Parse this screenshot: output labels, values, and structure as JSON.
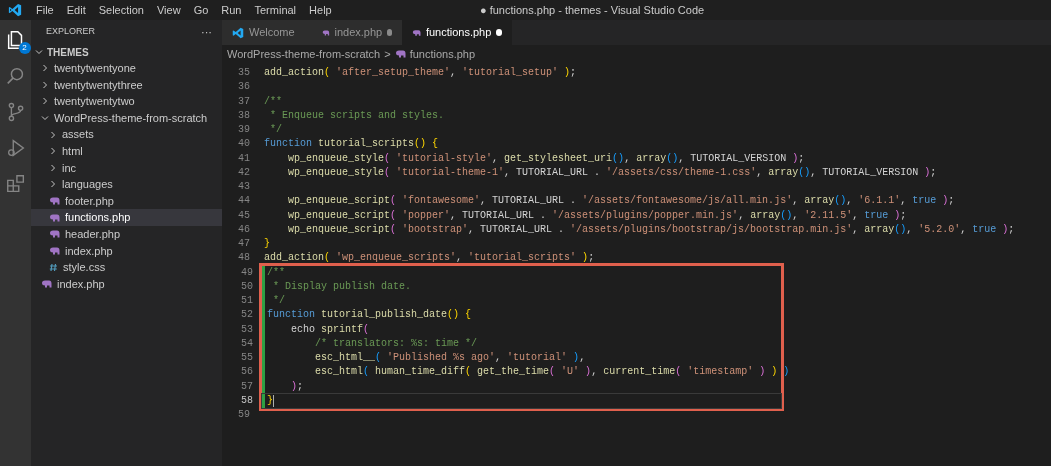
{
  "window": {
    "title": "● functions.php - themes - Visual Studio Code"
  },
  "menu": [
    "File",
    "Edit",
    "Selection",
    "View",
    "Go",
    "Run",
    "Terminal",
    "Help"
  ],
  "activity_bar": [
    {
      "kind": "files",
      "selected": true,
      "badge": "2"
    },
    {
      "kind": "search",
      "selected": false
    },
    {
      "kind": "branch",
      "selected": false
    },
    {
      "kind": "debug",
      "selected": false
    },
    {
      "kind": "blocks",
      "selected": false
    }
  ],
  "sidebar": {
    "title": "EXPLORER",
    "more": "···",
    "root": {
      "label": "THEMES",
      "expanded": true
    },
    "items": [
      {
        "label": "twentytwentyone",
        "kind": "folder",
        "expanded": false,
        "selected": false
      },
      {
        "label": "twentytwentythree",
        "kind": "folder",
        "expanded": false,
        "selected": false
      },
      {
        "label": "twentytwentytwo",
        "kind": "folder",
        "expanded": false,
        "selected": false
      },
      {
        "label": "WordPress-theme-from-scratch",
        "kind": "folder",
        "expanded": true,
        "selected": false,
        "children": [
          {
            "label": "assets",
            "kind": "folder",
            "expanded": false,
            "selected": false
          },
          {
            "label": "html",
            "kind": "folder",
            "expanded": false,
            "selected": false
          },
          {
            "label": "inc",
            "kind": "folder",
            "expanded": false,
            "selected": false
          },
          {
            "label": "languages",
            "kind": "folder",
            "expanded": false,
            "selected": false
          },
          {
            "label": "footer.php",
            "kind": "php",
            "selected": false
          },
          {
            "label": "functions.php",
            "kind": "php",
            "selected": true
          },
          {
            "label": "header.php",
            "kind": "php",
            "selected": false
          },
          {
            "label": "index.php",
            "kind": "php",
            "selected": false
          },
          {
            "label": "style.css",
            "kind": "css",
            "selected": false
          }
        ]
      },
      {
        "label": "index.php",
        "kind": "php",
        "selected": false
      }
    ]
  },
  "tabs": [
    {
      "label": "Welcome",
      "kind": "vscode",
      "selected": false,
      "modified": false
    },
    {
      "label": "index.php",
      "kind": "php",
      "selected": false,
      "modified": true
    },
    {
      "label": "functions.php",
      "kind": "php",
      "selected": true,
      "modified": true
    }
  ],
  "breadcrumb": [
    "WordPress-theme-from-scratch",
    ">",
    "functions.php"
  ],
  "code": {
    "blocks": [
      {
        "highlighted": false,
        "lines": [
          {
            "number": "35",
            "current": false,
            "tokens": [
              {
                "kind": "fn",
                "text": "add_action"
              },
              {
                "kind": "brace",
                "text": "( "
              },
              {
                "kind": "str",
                "text": "'after_setup_theme'"
              },
              {
                "kind": "plain",
                "text": ", "
              },
              {
                "kind": "str",
                "text": "'tutorial_setup'"
              },
              {
                "kind": "brace",
                "text": " )"
              },
              {
                "kind": "plain",
                "text": ";"
              }
            ]
          },
          {
            "number": "36",
            "current": false
          },
          {
            "number": "37",
            "current": false,
            "tokens": [
              {
                "kind": "comment",
                "text": "/**"
              }
            ]
          },
          {
            "number": "38",
            "current": false,
            "tokens": [
              {
                "kind": "comment",
                "text": " * Enqueue scripts and styles."
              }
            ]
          },
          {
            "number": "39",
            "current": false,
            "tokens": [
              {
                "kind": "comment",
                "text": " */"
              }
            ]
          },
          {
            "number": "40",
            "current": false,
            "tokens": [
              {
                "kind": "kw",
                "text": "function "
              },
              {
                "kind": "fn",
                "text": "tutorial_scripts"
              },
              {
                "kind": "brace",
                "text": "() {"
              }
            ]
          },
          {
            "number": "41",
            "current": false,
            "tokens": [
              {
                "kind": "fn",
                "text": "    wp_enqueue_style"
              },
              {
                "kind": "paren",
                "text": "( "
              },
              {
                "kind": "str",
                "text": "'tutorial-style'"
              },
              {
                "kind": "plain",
                "text": ", "
              },
              {
                "kind": "fn",
                "text": "get_stylesheet_uri"
              },
              {
                "kind": "call",
                "text": "()"
              },
              {
                "kind": "plain",
                "text": ", "
              },
              {
                "kind": "fn",
                "text": "array"
              },
              {
                "kind": "call",
                "text": "()"
              },
              {
                "kind": "plain",
                "text": ", TUTORIAL_VERSION "
              },
              {
                "kind": "paren",
                "text": ")"
              },
              {
                "kind": "plain",
                "text": ";"
              }
            ]
          },
          {
            "number": "42",
            "current": false,
            "tokens": [
              {
                "kind": "fn",
                "text": "    wp_enqueue_style"
              },
              {
                "kind": "paren",
                "text": "( "
              },
              {
                "kind": "str",
                "text": "'tutorial-theme-1'"
              },
              {
                "kind": "plain",
                "text": ", TUTORIAL_URL . "
              },
              {
                "kind": "str",
                "text": "'/assets/css/theme-1.css'"
              },
              {
                "kind": "plain",
                "text": ", "
              },
              {
                "kind": "fn",
                "text": "array"
              },
              {
                "kind": "call",
                "text": "()"
              },
              {
                "kind": "plain",
                "text": ", TUTORIAL_VERSION "
              },
              {
                "kind": "paren",
                "text": ")"
              },
              {
                "kind": "plain",
                "text": ";"
              }
            ]
          },
          {
            "number": "43",
            "current": false
          },
          {
            "number": "44",
            "current": false,
            "tokens": [
              {
                "kind": "fn",
                "text": "    wp_enqueue_script"
              },
              {
                "kind": "paren",
                "text": "( "
              },
              {
                "kind": "str",
                "text": "'fontawesome'"
              },
              {
                "kind": "plain",
                "text": ", TUTORIAL_URL . "
              },
              {
                "kind": "str",
                "text": "'/assets/fontawesome/js/all.min.js'"
              },
              {
                "kind": "plain",
                "text": ", "
              },
              {
                "kind": "fn",
                "text": "array"
              },
              {
                "kind": "call",
                "text": "()"
              },
              {
                "kind": "plain",
                "text": ", "
              },
              {
                "kind": "str",
                "text": "'6.1.1'"
              },
              {
                "kind": "plain",
                "text": ", "
              },
              {
                "kind": "kw",
                "text": "true "
              },
              {
                "kind": "paren",
                "text": ")"
              },
              {
                "kind": "plain",
                "text": ";"
              }
            ]
          },
          {
            "number": "45",
            "current": false,
            "tokens": [
              {
                "kind": "fn",
                "text": "    wp_enqueue_script"
              },
              {
                "kind": "paren",
                "text": "( "
              },
              {
                "kind": "str",
                "text": "'popper'"
              },
              {
                "kind": "plain",
                "text": ", TUTORIAL_URL . "
              },
              {
                "kind": "str",
                "text": "'/assets/plugins/popper.min.js'"
              },
              {
                "kind": "plain",
                "text": ", "
              },
              {
                "kind": "fn",
                "text": "array"
              },
              {
                "kind": "call",
                "text": "()"
              },
              {
                "kind": "plain",
                "text": ", "
              },
              {
                "kind": "str",
                "text": "'2.11.5'"
              },
              {
                "kind": "plain",
                "text": ", "
              },
              {
                "kind": "kw",
                "text": "true "
              },
              {
                "kind": "paren",
                "text": ")"
              },
              {
                "kind": "plain",
                "text": ";"
              }
            ]
          },
          {
            "number": "46",
            "current": false,
            "tokens": [
              {
                "kind": "fn",
                "text": "    wp_enqueue_script"
              },
              {
                "kind": "paren",
                "text": "( "
              },
              {
                "kind": "str",
                "text": "'bootstrap'"
              },
              {
                "kind": "plain",
                "text": ", TUTORIAL_URL . "
              },
              {
                "kind": "str",
                "text": "'/assets/plugins/bootstrap/js/bootstrap.min.js'"
              },
              {
                "kind": "plain",
                "text": ", "
              },
              {
                "kind": "fn",
                "text": "array"
              },
              {
                "kind": "call",
                "text": "()"
              },
              {
                "kind": "plain",
                "text": ", "
              },
              {
                "kind": "str",
                "text": "'5.2.0'"
              },
              {
                "kind": "plain",
                "text": ", "
              },
              {
                "kind": "kw",
                "text": "true "
              },
              {
                "kind": "paren",
                "text": ")"
              },
              {
                "kind": "plain",
                "text": ";"
              }
            ]
          },
          {
            "number": "47",
            "current": false,
            "tokens": [
              {
                "kind": "brace",
                "text": "}"
              }
            ]
          },
          {
            "number": "48",
            "current": false,
            "tokens": [
              {
                "kind": "fn",
                "text": "add_action"
              },
              {
                "kind": "brace",
                "text": "( "
              },
              {
                "kind": "str",
                "text": "'wp_enqueue_scripts'"
              },
              {
                "kind": "plain",
                "text": ", "
              },
              {
                "kind": "str",
                "text": "'tutorial_scripts'"
              },
              {
                "kind": "brace",
                "text": " )"
              },
              {
                "kind": "plain",
                "text": ";"
              }
            ]
          }
        ]
      },
      {
        "highlighted": true,
        "lines": [
          {
            "number": "49",
            "current": false,
            "tokens": [
              {
                "kind": "comment",
                "text": "/**"
              }
            ]
          },
          {
            "number": "50",
            "current": false,
            "tokens": [
              {
                "kind": "comment",
                "text": " * Display publish date."
              }
            ]
          },
          {
            "number": "51",
            "current": false,
            "tokens": [
              {
                "kind": "comment",
                "text": " */"
              }
            ]
          },
          {
            "number": "52",
            "current": false,
            "tokens": [
              {
                "kind": "kw",
                "text": "function "
              },
              {
                "kind": "fn",
                "text": "tutorial_publish_date"
              },
              {
                "kind": "brace",
                "text": "() {"
              }
            ]
          },
          {
            "number": "53",
            "current": false,
            "tokens": [
              {
                "kind": "plain",
                "text": "    echo "
              },
              {
                "kind": "fn",
                "text": "sprintf"
              },
              {
                "kind": "paren",
                "text": "("
              }
            ]
          },
          {
            "number": "54",
            "current": false,
            "tokens": [
              {
                "kind": "comment",
                "text": "        /* translators: %s: time */"
              }
            ]
          },
          {
            "number": "55",
            "current": false,
            "tokens": [
              {
                "kind": "fn",
                "text": "        esc_html__"
              },
              {
                "kind": "call",
                "text": "( "
              },
              {
                "kind": "str",
                "text": "'Published %s ago'"
              },
              {
                "kind": "plain",
                "text": ", "
              },
              {
                "kind": "str",
                "text": "'tutorial'"
              },
              {
                "kind": "call",
                "text": " )"
              },
              {
                "kind": "plain",
                "text": ","
              }
            ]
          },
          {
            "number": "56",
            "current": false,
            "tokens": [
              {
                "kind": "fn",
                "text": "        esc_html"
              },
              {
                "kind": "call",
                "text": "( "
              },
              {
                "kind": "fn",
                "text": "human_time_diff"
              },
              {
                "kind": "brace",
                "text": "( "
              },
              {
                "kind": "fn",
                "text": "get_the_time"
              },
              {
                "kind": "paren",
                "text": "( "
              },
              {
                "kind": "str",
                "text": "'U'"
              },
              {
                "kind": "paren",
                "text": " )"
              },
              {
                "kind": "plain",
                "text": ", "
              },
              {
                "kind": "fn",
                "text": "current_time"
              },
              {
                "kind": "paren",
                "text": "( "
              },
              {
                "kind": "str",
                "text": "'timestamp'"
              },
              {
                "kind": "paren",
                "text": " )"
              },
              {
                "kind": "brace",
                "text": " )"
              },
              {
                "kind": "call",
                "text": " )"
              }
            ]
          },
          {
            "number": "57",
            "current": false,
            "tokens": [
              {
                "kind": "paren",
                "text": "    )"
              },
              {
                "kind": "plain",
                "text": ";"
              }
            ]
          },
          {
            "number": "58",
            "current": true,
            "tokens": [
              {
                "kind": "brace",
                "text": "}"
              }
            ]
          }
        ]
      },
      {
        "highlighted": false,
        "lines": [
          {
            "number": "59",
            "current": false
          }
        ]
      }
    ]
  }
}
